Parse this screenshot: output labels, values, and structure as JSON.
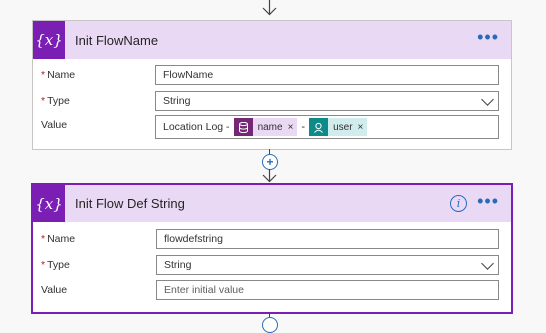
{
  "card1": {
    "title": "Init FlowName",
    "icon": "{x}",
    "more": "•••",
    "name_label": "Name",
    "name_value": "FlowName",
    "type_label": "Type",
    "type_value": "String",
    "value_label": "Value",
    "value_text": "Location Log -",
    "token1": {
      "label": "name",
      "icon": "database-icon",
      "color": "#742774"
    },
    "separator": "-",
    "token2": {
      "label": "user",
      "icon": "user-icon",
      "color": "#0f8a8a"
    },
    "remove": "×"
  },
  "card2": {
    "title": "Init Flow Def String",
    "icon": "{x}",
    "more": "•••",
    "info": "i",
    "name_label": "Name",
    "name_value": "flowdefstring",
    "type_label": "Type",
    "type_value": "String",
    "value_label": "Value",
    "value_placeholder": "Enter initial value"
  },
  "required_marker": "*",
  "add_step": "+",
  "colors": {
    "accent": "#7a1eb4",
    "header_bg": "#ead9f5",
    "link": "#2a6bb8"
  }
}
